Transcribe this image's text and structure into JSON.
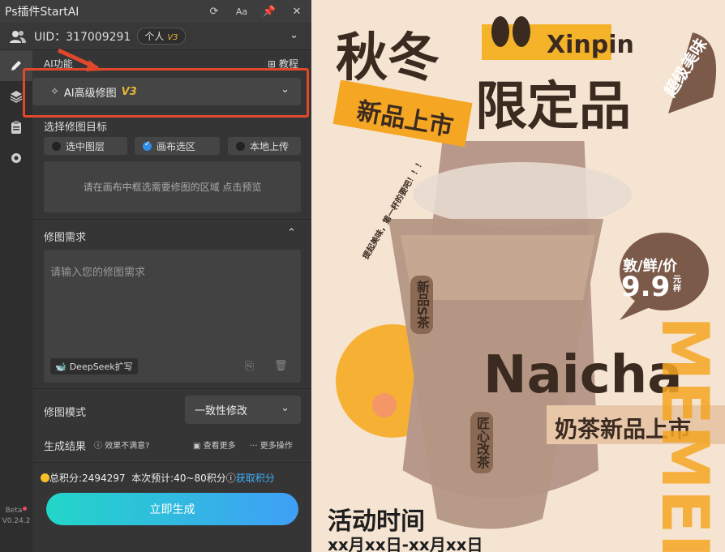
{
  "app": {
    "title": "Ps插件StartAI"
  },
  "user": {
    "uid_label": "UID：",
    "uid": "317009291",
    "plan": "个人",
    "plan_version": "V3"
  },
  "section": {
    "ai_function_label": "AI功能",
    "tutorial_label": "教程"
  },
  "feature_select": {
    "label": "AI高级修图",
    "version": "V3"
  },
  "target": {
    "title": "选择修图目标",
    "options": [
      "选中图层",
      "画布选区",
      "本地上传"
    ],
    "selected_index": 1,
    "hint": "请在画布中框选需要修图的区域 点击预览"
  },
  "requirements": {
    "title": "修图需求",
    "placeholder": "请输入您的修图需求",
    "deepseek_label": "DeepSeek扩写"
  },
  "mode": {
    "label": "修图模式",
    "value": "一致性修改"
  },
  "result": {
    "label": "生成结果",
    "feedback": "效果不满意?",
    "view_more": "查看更多",
    "more_actions": "更多操作"
  },
  "points": {
    "total": "总积分:2494297",
    "estimate": "本次预计:40~80积分",
    "get_points": "获取积分"
  },
  "generate_button": "立即生成",
  "version": {
    "beta": "Beta",
    "number": "V0.24.2"
  },
  "poster": {
    "title_line1": "秋冬",
    "title_line2": "限定品",
    "brand": "Xinpin",
    "tag_new": "新品上市",
    "tag_tasty": "超级美味",
    "slogan": "提起美味，第一杯的要吧！！！",
    "cup_label1": "新品S茶",
    "cup_label2": "匠心改茶",
    "price_label": "敦/鲜/价",
    "price": "9.9",
    "price_unit": "元样",
    "product_en": "Naicha",
    "product_cn": "奶茶新品上市",
    "side_text": "MEMEI",
    "event_title": "活动时间",
    "event_date": "xx月xx日-xx月xx日"
  },
  "colors": {
    "accent_orange": "#f5a623",
    "brand_brown": "#3a2a20",
    "panel_bg": "#353535",
    "highlight_red": "#e0482b",
    "gradient_start": "#22d6c8",
    "gradient_end": "#3f9ff7",
    "gold": "#e7b43a"
  }
}
